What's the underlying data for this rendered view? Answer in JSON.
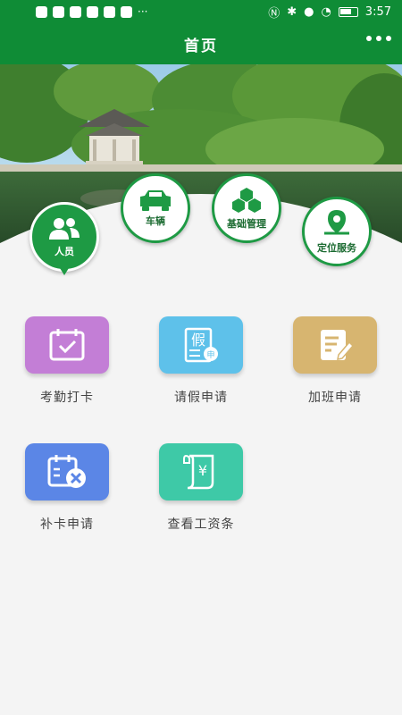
{
  "status_bar": {
    "time": "3:57",
    "more": "···"
  },
  "header": {
    "title": "首页"
  },
  "categories": [
    {
      "label": "人员",
      "icon": "people-icon",
      "active": true
    },
    {
      "label": "车辆",
      "icon": "car-icon"
    },
    {
      "label": "基础管理",
      "icon": "cubes-icon"
    },
    {
      "label": "定位服务",
      "icon": "location-icon"
    }
  ],
  "tiles": [
    {
      "label": "考勤打卡",
      "icon": "calendar-check-icon",
      "color": "#c37ed6"
    },
    {
      "label": "请假申请",
      "icon": "leave-form-icon",
      "color": "#5ec1ea",
      "icon_text": "假",
      "stamp": "申"
    },
    {
      "label": "加班申请",
      "icon": "edit-note-icon",
      "color": "#d7b570"
    },
    {
      "label": "补卡申请",
      "icon": "calendar-x-icon",
      "color": "#5b86e6"
    },
    {
      "label": "查看工资条",
      "icon": "salary-scroll-icon",
      "color": "#3ec9a7",
      "icon_text": "¥"
    }
  ]
}
